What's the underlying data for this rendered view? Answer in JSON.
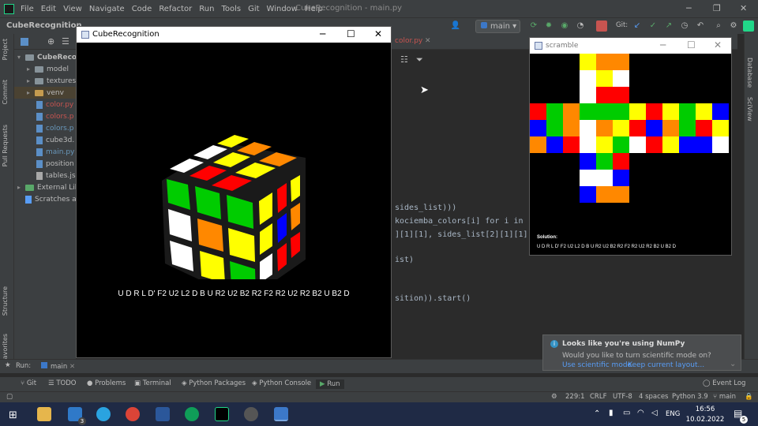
{
  "ide": {
    "menu": [
      "File",
      "Edit",
      "View",
      "Navigate",
      "Code",
      "Refactor",
      "Run",
      "Tools",
      "Git",
      "Window",
      "Help"
    ],
    "title": "CubeRecognition - main.py",
    "project_name": "CubeRecognition",
    "branch": "main",
    "git_label": "Git:",
    "editor_tab": "color.py"
  },
  "project_tree": {
    "root": "CubeRecog",
    "items": [
      {
        "label": "model",
        "type": "folder"
      },
      {
        "label": "textures",
        "type": "folder"
      },
      {
        "label": "venv",
        "type": "folder"
      },
      {
        "label": "color.py",
        "type": "file"
      },
      {
        "label": "colors.p",
        "type": "file"
      },
      {
        "label": "colors.p",
        "type": "file"
      },
      {
        "label": "cube3d.",
        "type": "file"
      },
      {
        "label": "main.py",
        "type": "file"
      },
      {
        "label": "position",
        "type": "file"
      },
      {
        "label": "tables.js",
        "type": "file"
      }
    ],
    "external": "External Libr",
    "scratches": "Scratches a"
  },
  "left_tabs": [
    "Project",
    "Commit",
    "Pull Requests",
    "Structure",
    "Favorites"
  ],
  "right_tabs": [
    "Database",
    "SciView"
  ],
  "code": [
    "sides_list)))",
    "kociemba_colors[i] for i in r",
    "][1][1], sides_list[2][1][1])",
    "ist)",
    "sition)).start()"
  ],
  "cube_window": {
    "title": "CubeRecognition",
    "solution": "U D R L D' F2 U2 L2 D B U R2 U2 B2 R2 F2 R2 U2 R2 B2 U B2 D"
  },
  "scramble_window": {
    "title": "scramble",
    "solution_label": "Solution:",
    "solution": "U D R L D' F2 U2 L2 D B U R2 U2 B2 R2 F2 R2 U2 R2 B2 U B2 D"
  },
  "notification": {
    "title": "Looks like you're using NumPy",
    "body": "Would you like to turn scientific mode on?",
    "link1": "Use scientific mode",
    "link2": "Keep current layout..."
  },
  "run_bar": {
    "label": "Run:",
    "tab": "main"
  },
  "bottom_tabs": [
    "Git",
    "TODO",
    "Problems",
    "Terminal",
    "Python Packages",
    "Python Console",
    "Run"
  ],
  "event_log": "Event Log",
  "status": {
    "position": "229:1",
    "line_sep": "CRLF",
    "encoding": "UTF-8",
    "indent": "4 spaces",
    "interpreter": "Python 3.9",
    "branch": "main"
  },
  "taskbar": {
    "time": "16:56",
    "date": "10.02.2022",
    "lang": "ENG",
    "mail_badge": "3",
    "notif_badge": "5"
  },
  "colors": {
    "cube_yellow": "#ffff00",
    "cube_orange": "#ff8800",
    "cube_red": "#ff0000",
    "cube_green": "#00cc00",
    "cube_blue": "#0000ff",
    "cube_white": "#ffffff"
  }
}
